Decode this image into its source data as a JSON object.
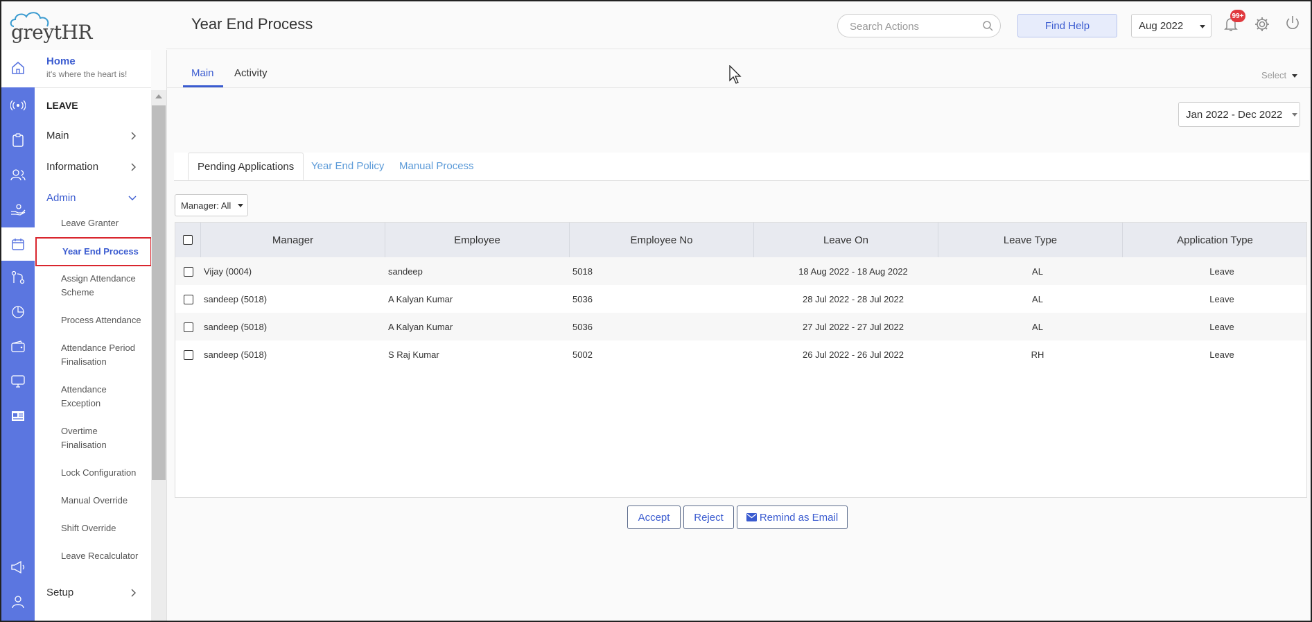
{
  "app": {
    "logo_text": "greytHR",
    "page_title": "Year End Process"
  },
  "header": {
    "search_placeholder": "Search Actions",
    "find_help": "Find Help",
    "month": "Aug 2022",
    "notification_badge": "99+",
    "icons": [
      "search-icon",
      "bell-icon",
      "gear-icon",
      "power-icon"
    ]
  },
  "sidebar": {
    "home": {
      "title": "Home",
      "subtitle": "it's where the heart is!"
    },
    "section_label": "LEAVE",
    "groups": [
      {
        "label": "Main",
        "icon": "chevron-right"
      },
      {
        "label": "Information",
        "icon": "chevron-right"
      },
      {
        "label": "Admin",
        "icon": "chevron-down"
      }
    ],
    "admin_items": [
      {
        "line1": "Leave Granter",
        "line2": ""
      },
      {
        "line1": "Year End Process",
        "line2": ""
      },
      {
        "line1": "Assign Attendance",
        "line2": "Scheme"
      },
      {
        "line1": "Process Attendance",
        "line2": ""
      },
      {
        "line1": "Attendance Period",
        "line2": "Finalisation"
      },
      {
        "line1": "Attendance",
        "line2": "Exception"
      },
      {
        "line1": "Overtime",
        "line2": "Finalisation"
      },
      {
        "line1": "Lock Configuration",
        "line2": ""
      },
      {
        "line1": "Manual Override",
        "line2": ""
      },
      {
        "line1": "Shift Override",
        "line2": ""
      },
      {
        "line1": "Leave Recalculator",
        "line2": ""
      }
    ],
    "setup": "Setup",
    "rail_icons": [
      "home-icon",
      "broadcast-icon",
      "clipboard-icon",
      "people-icon",
      "hand-icon",
      "calendar-icon",
      "flow-icon",
      "pie-chart-icon",
      "wallet-icon",
      "monitor-icon",
      "news-icon",
      "megaphone-icon",
      "user-icon"
    ]
  },
  "tabs": {
    "main": "Main",
    "activity": "Activity",
    "select": "Select"
  },
  "period": "Jan 2022 - Dec 2022",
  "subtabs": [
    "Pending Applications",
    "Year End Policy",
    "Manual Process"
  ],
  "manager_filter": "Manager: All",
  "table": {
    "columns": [
      "Manager",
      "Employee",
      "Employee No",
      "Leave On",
      "Leave Type",
      "Application Type"
    ],
    "rows": [
      {
        "manager": "Vijay (0004)",
        "employee": "sandeep",
        "emp_no": "5018",
        "leave_on": "18 Aug 2022 - 18 Aug 2022",
        "leave_type": "AL",
        "app_type": "Leave"
      },
      {
        "manager": "sandeep (5018)",
        "employee": "A Kalyan Kumar",
        "emp_no": "5036",
        "leave_on": "28 Jul 2022 - 28 Jul 2022",
        "leave_type": "AL",
        "app_type": "Leave"
      },
      {
        "manager": "sandeep (5018)",
        "employee": "A Kalyan Kumar",
        "emp_no": "5036",
        "leave_on": "27 Jul 2022 - 27 Jul 2022",
        "leave_type": "AL",
        "app_type": "Leave"
      },
      {
        "manager": "sandeep (5018)",
        "employee": "S Raj Kumar",
        "emp_no": "5002",
        "leave_on": "26 Jul 2022 - 26 Jul 2022",
        "leave_type": "RH",
        "app_type": "Leave"
      }
    ]
  },
  "actions": {
    "accept": "Accept",
    "reject": "Reject",
    "remind": "Remind as Email"
  },
  "colors": {
    "accent": "#3a5bd0",
    "rail": "#5b76e0",
    "highlight_border": "#d9262e",
    "badge": "#e0393e"
  }
}
